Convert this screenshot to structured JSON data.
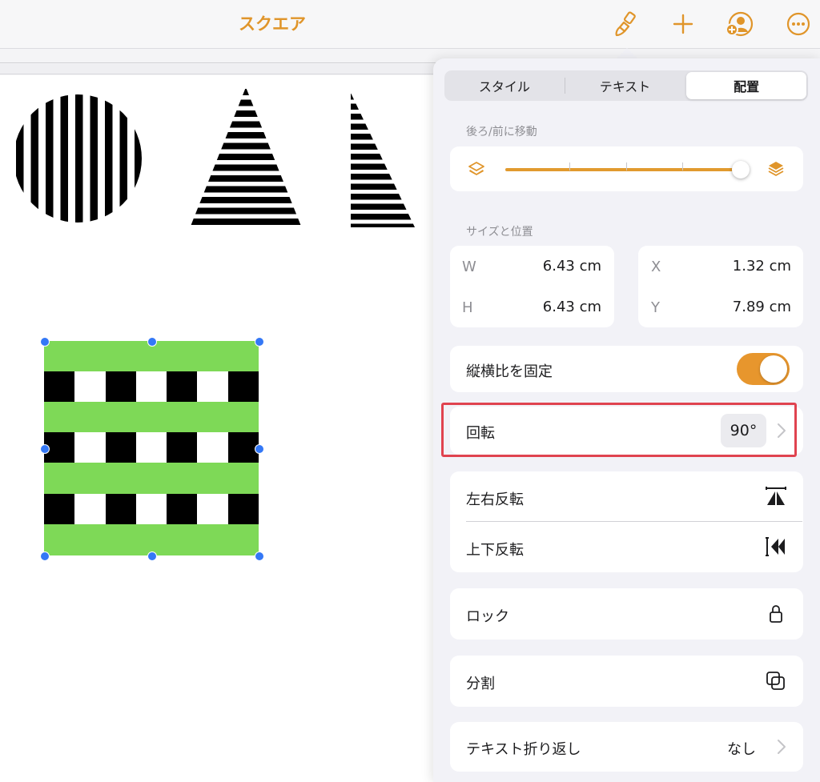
{
  "toolbar": {
    "title": "スクエア",
    "icons": [
      "paintbrush-icon",
      "plus-icon",
      "add-collaborator-icon",
      "more-icon"
    ]
  },
  "inspector": {
    "tabs": [
      {
        "label": "スタイル",
        "selected": false
      },
      {
        "label": "テキスト",
        "selected": false
      },
      {
        "label": "配置",
        "selected": true
      }
    ],
    "move_section": {
      "label": "後ろ/前に移動",
      "slider_value": 1.0
    },
    "size_section": {
      "label": "サイズと位置",
      "w_key": "W",
      "w_value": "6.43 cm",
      "h_key": "H",
      "h_value": "6.43 cm",
      "x_key": "X",
      "x_value": "1.32 cm",
      "y_key": "Y",
      "y_value": "7.89 cm"
    },
    "aspect_lock": {
      "label": "縦横比を固定",
      "on": true
    },
    "rotate": {
      "label": "回転",
      "value": "90°"
    },
    "flip_horizontal": {
      "label": "左右反転"
    },
    "flip_vertical": {
      "label": "上下反転"
    },
    "lock": {
      "label": "ロック"
    },
    "split": {
      "label": "分割"
    },
    "text_wrap": {
      "label": "テキスト折り返し",
      "value": "なし"
    }
  },
  "colors": {
    "accent": "#e0952a",
    "highlight": "#e0434f",
    "shape_green": "#7ed957",
    "selection": "#3478f6"
  }
}
